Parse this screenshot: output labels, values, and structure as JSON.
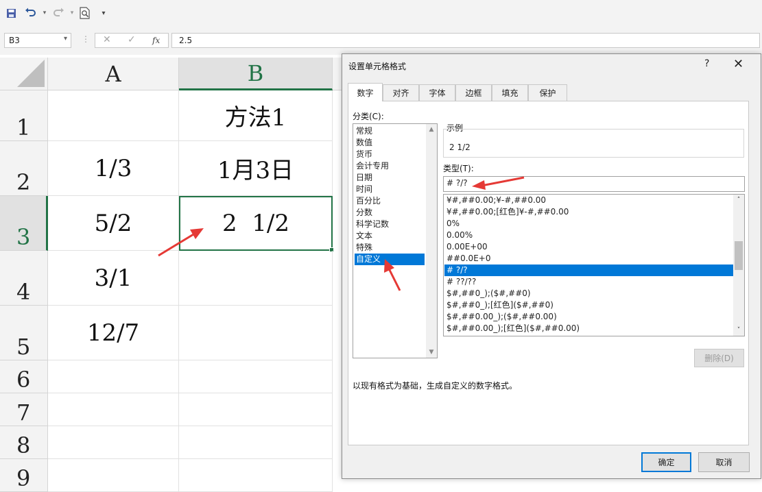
{
  "formula_bar": {
    "name_box": "B3",
    "formula": "2.5",
    "fx_label": "fx"
  },
  "sheet": {
    "columns": [
      "A",
      "B"
    ],
    "rows": [
      "1",
      "2",
      "3",
      "4",
      "5",
      "6",
      "7",
      "8",
      "9"
    ],
    "selected_column": "B",
    "selected_row": "3",
    "cells": {
      "B1": "方法1",
      "A2": "1/3",
      "B2": "1月3日",
      "A3": "5/2",
      "B3": "2  1/2",
      "A4": "3/1",
      "A5": "12/7"
    }
  },
  "dialog": {
    "title": "设置单元格格式",
    "help": "?",
    "close": "✕",
    "tabs": [
      "数字",
      "对齐",
      "字体",
      "边框",
      "填充",
      "保护"
    ],
    "active_tab": "数字",
    "category_label": "分类(C):",
    "categories": [
      "常规",
      "数值",
      "货币",
      "会计专用",
      "日期",
      "时间",
      "百分比",
      "分数",
      "科学记数",
      "文本",
      "特殊",
      "自定义"
    ],
    "selected_category": "自定义",
    "sample_label": "示例",
    "sample_value": "2 1/2",
    "type_label": "类型(T):",
    "type_value": "# ?/?",
    "formats": [
      "¥#,##0.00;¥-#,##0.00",
      "¥#,##0.00;[红色]¥-#,##0.00",
      "0%",
      "0.00%",
      "0.00E+00",
      "##0.0E+0",
      "# ?/?",
      "# ??/??",
      "$#,##0_);($#,##0)",
      "$#,##0_);[红色]($#,##0)",
      "$#,##0.00_);($#,##0.00)",
      "$#,##0.00_);[红色]($#,##0.00)"
    ],
    "selected_format": "# ?/?",
    "delete_button": "删除(D)",
    "description": "以现有格式为基础，生成自定义的数字格式。",
    "ok_button": "确定",
    "cancel_button": "取消"
  },
  "colors": {
    "excel_green": "#217346",
    "selection_blue": "#0078d7",
    "annotation_red": "#e53935"
  }
}
